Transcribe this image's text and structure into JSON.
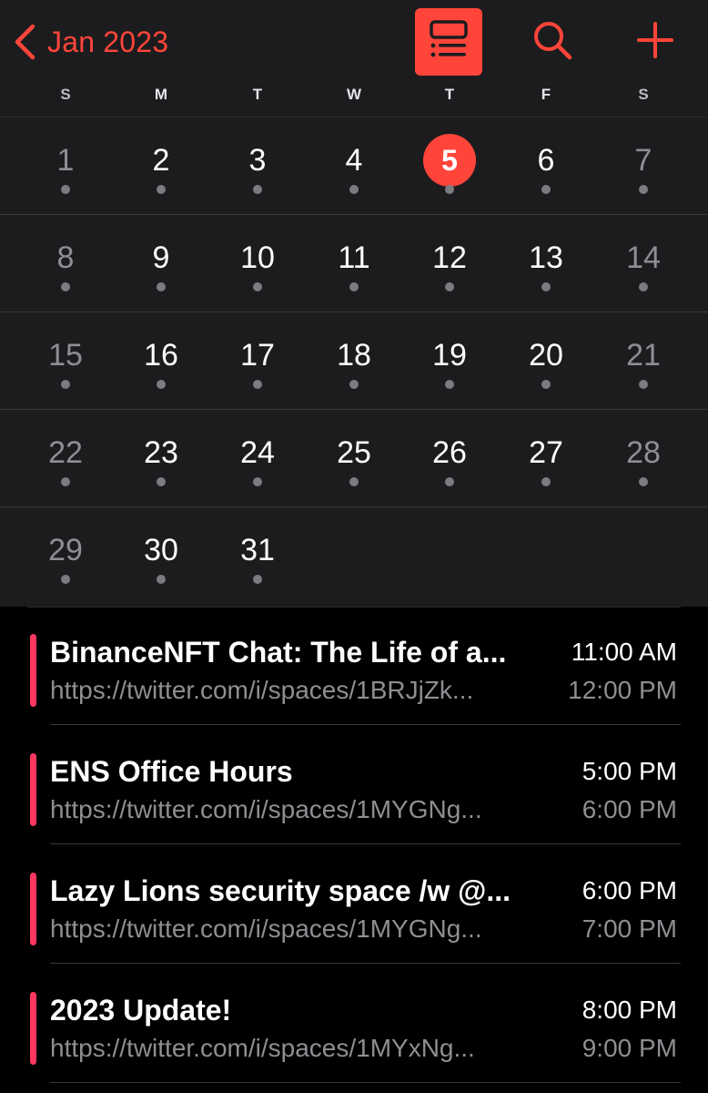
{
  "header": {
    "back_label": "Jan 2023",
    "accent_color": "#ff453a",
    "icons": {
      "back": "chevron-left-icon",
      "list_toggle": "list-view-icon",
      "search": "search-icon",
      "add": "plus-icon"
    }
  },
  "weekdays": [
    "S",
    "M",
    "T",
    "W",
    "T",
    "F",
    "S"
  ],
  "calendar": {
    "today": 5,
    "weeks": [
      [
        1,
        2,
        3,
        4,
        5,
        6,
        7
      ],
      [
        8,
        9,
        10,
        11,
        12,
        13,
        14
      ],
      [
        15,
        16,
        17,
        18,
        19,
        20,
        21
      ],
      [
        22,
        23,
        24,
        25,
        26,
        27,
        28
      ],
      [
        29,
        30,
        31
      ]
    ]
  },
  "events": [
    {
      "title": "BinanceNFT Chat: The Life of a...",
      "url": "https://twitter.com/i/spaces/1BRJjZk...",
      "start": "11:00 AM",
      "end": "12:00 PM",
      "color": "#ff375f"
    },
    {
      "title": "ENS Office Hours",
      "url": "https://twitter.com/i/spaces/1MYGNg...",
      "start": "5:00 PM",
      "end": "6:00 PM",
      "color": "#ff375f"
    },
    {
      "title": "Lazy Lions security space /w @...",
      "url": "https://twitter.com/i/spaces/1MYGNg...",
      "start": "6:00 PM",
      "end": "7:00 PM",
      "color": "#ff375f"
    },
    {
      "title": "2023 Update!",
      "url": "https://twitter.com/i/spaces/1MYxNg...",
      "start": "8:00 PM",
      "end": "9:00 PM",
      "color": "#ff375f"
    }
  ]
}
